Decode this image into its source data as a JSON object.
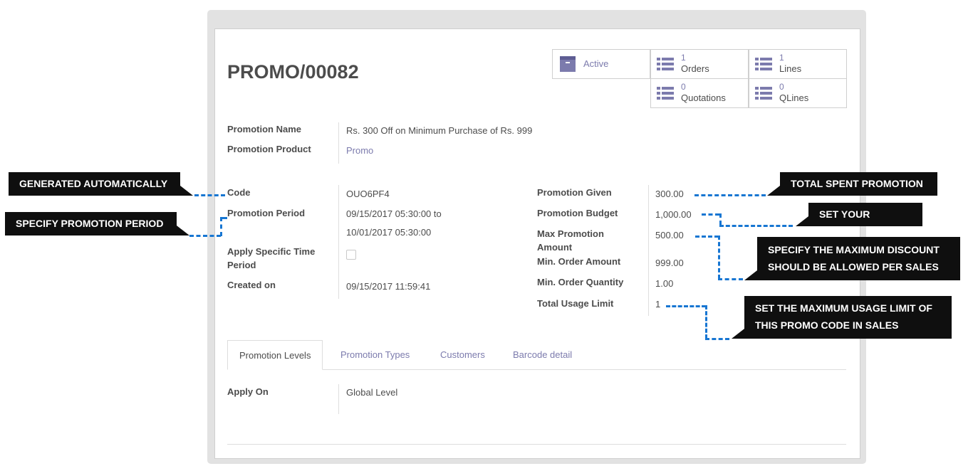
{
  "record": {
    "title": "PROMO/00082"
  },
  "smart_buttons": {
    "active": {
      "label": "Active",
      "icon": "archive-icon"
    },
    "orders": {
      "count": "1",
      "label": "Orders",
      "icon": "list-icon"
    },
    "lines": {
      "count": "1",
      "label": "Lines",
      "icon": "list-icon"
    },
    "quotations": {
      "count": "0",
      "label": "Quotations",
      "icon": "list-icon"
    },
    "qlines": {
      "count": "0",
      "label": "QLines",
      "icon": "list-icon"
    }
  },
  "fields": {
    "promotion_name": {
      "label": "Promotion Name",
      "value": "Rs. 300 Off on Minimum Purchase of Rs. 999"
    },
    "promotion_product": {
      "label": "Promotion Product",
      "value": "Promo"
    },
    "code": {
      "label": "Code",
      "value": "OUO6PF4"
    },
    "promotion_period": {
      "label": "Promotion Period",
      "value_from": "09/15/2017 05:30:00 to",
      "value_to": "10/01/2017 05:30:00"
    },
    "apply_specific_time": {
      "label_line1": "Apply Specific Time",
      "label_line2": "Period",
      "checked": false
    },
    "created_on": {
      "label": "Created on",
      "value": "09/15/2017 11:59:41"
    },
    "promotion_given": {
      "label": "Promotion Given",
      "value": "300.00"
    },
    "promotion_budget": {
      "label": "Promotion Budget",
      "value": "1,000.00"
    },
    "max_promotion_amount": {
      "label_line1": "Max Promotion",
      "label_line2": "Amount",
      "value": "500.00"
    },
    "min_order_amount": {
      "label": "Min. Order Amount",
      "value": "999.00"
    },
    "min_order_quantity": {
      "label": "Min. Order Quantity",
      "value": "1.00"
    },
    "total_usage_limit": {
      "label": "Total Usage Limit",
      "value": "1"
    }
  },
  "tabs": [
    "Promotion Levels",
    "Promotion Types",
    "Customers",
    "Barcode detail"
  ],
  "tab_content": {
    "apply_on": {
      "label": "Apply On",
      "value": "Global Level"
    }
  },
  "callouts": {
    "generated": "GENERATED AUTOMATICALLY",
    "period": "SPECIFY PROMOTION PERIOD",
    "spent": "TOTAL SPENT PROMOTION",
    "target": "SET YOUR TARGET",
    "max_discount_line1": "SPECIFY THE MAXIMUM DISCOUNT",
    "max_discount_line2": "SHOULD BE ALLOWED PER SALES",
    "usage_line1": "SET THE MAXIMUM USAGE LIMIT OF",
    "usage_line2": "THIS PROMO CODE IN SALES"
  },
  "colors": {
    "accent": "#7c7bad",
    "callout_bg": "#0f0f0f",
    "dash": "#1776d2"
  }
}
